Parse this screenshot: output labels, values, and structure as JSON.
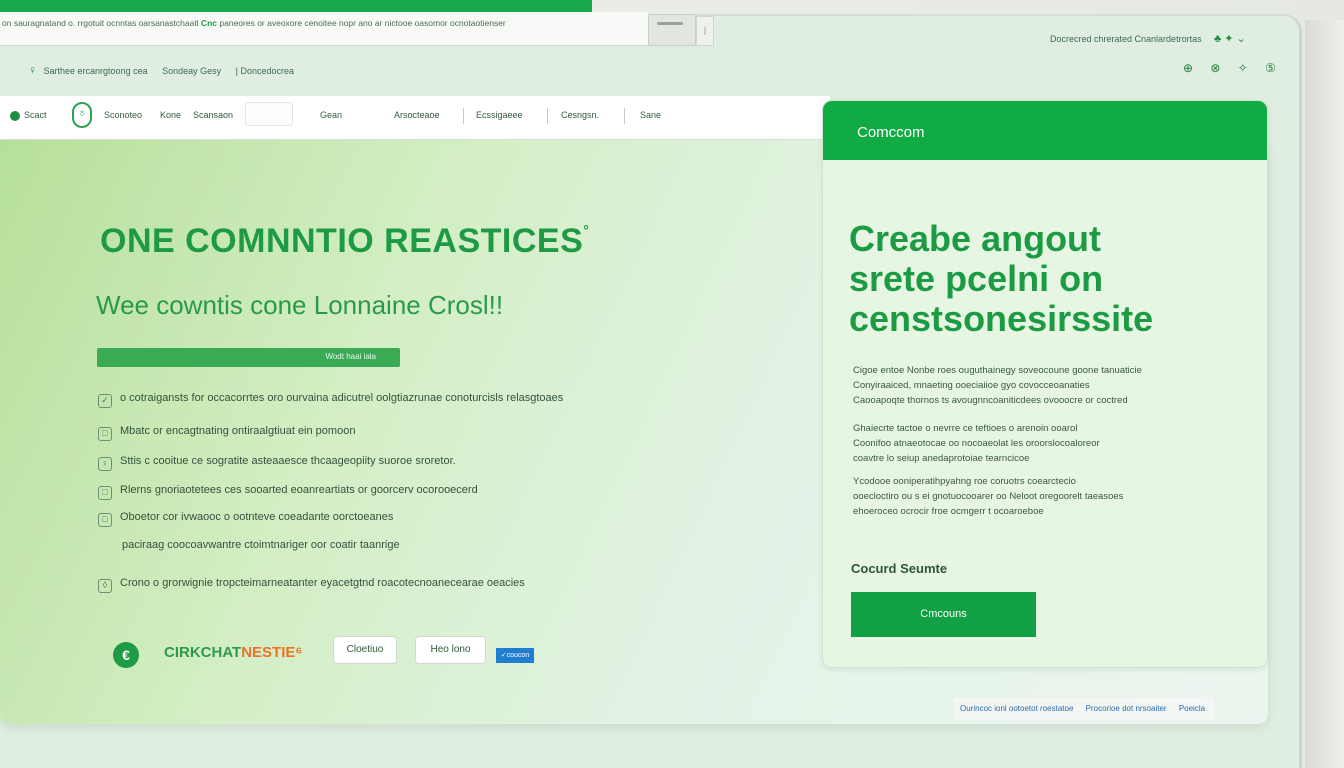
{
  "browser": {
    "url_text": "on sauragnatand o. rrgotuit ocnntas oarsanastchaatl",
    "url_highlight": "Cnc",
    "url_tail": "paneores or aveoxore cenoitee nopr ano ar nictooe oasomor ocnotaotienser",
    "tab_chevron": "|"
  },
  "top_right": {
    "text": "Docrecred chrerated Cnanlardetrortas",
    "icons": "♣ ✦ ⌄",
    "status_icons": "⊕ ⊗ ✧ ⑤"
  },
  "subheader": {
    "pin_icon": "♀",
    "links": [
      "Sarthee ercanrgtoong cea",
      "Sondeay Gesy",
      "| Doncedocrea"
    ]
  },
  "nav": {
    "items": [
      "Scact",
      "Sconoteo",
      "Kone",
      "Scansaon",
      "Gean",
      "Arsocteaoe",
      "Ecssigaeee",
      "Cesngsn.",
      "Sane"
    ],
    "logo_icon": "♁"
  },
  "hero": {
    "title": "ONE COMNNTIO  REASTICES",
    "title_mark": "°",
    "subtitle": "Wee cowntis cone  Lonnaine Crosl!!",
    "bar_label": "Wodt haai iala",
    "features": [
      {
        "icon": "✓",
        "text": "o cotraigansts for occacorrtes oro ourvaina adicutrel oolgtiazrunae conoturcisls relasgtoaes"
      },
      {
        "icon": "□",
        "text": "Mbatc or encagtnating ontiraalgtiuat ein pomoon"
      },
      {
        "icon": "♀",
        "text": "Sttis c cooitue ce sogratite asteaaesce thcaageopiity suoroe sroretor."
      },
      {
        "icon": "□",
        "text": "Rlerns gnoriaotetees ces sooarted eoanreartiats or goorcerv ocorooecerd"
      },
      {
        "icon": "□",
        "text": "Oboetor cor ivwaooc o ootnteve coeadante oorctoeanes"
      },
      {
        "icon": "",
        "text": "paciraag coocoavwantre ctoimtnariger oor coatir taanrige"
      },
      {
        "icon": "◊",
        "text": "Crono o grorwignie tropcteimarneatanter eyacetgtnd roacotecnoanecearae oeacies"
      }
    ],
    "brand_logo_icon": "€",
    "brand_name": "CIRKCHAT",
    "brand_accent": "NESTIE⁶",
    "buttons": [
      "Cloetiuo",
      "Heo lono"
    ],
    "blue_button": "✓coucon"
  },
  "card": {
    "header": "Comccom",
    "title_lines": [
      "Creabe angout",
      "srete  pcelni on",
      "censtsonesirssite"
    ],
    "paragraphs": [
      [
        "Cigoe entoe Nonbe roes ouguthainegy soveocoune goone tanuaticie",
        "Conyiraaiced, mnaeting ooeciaiioe gyo covocceoanaties",
        "Caooapoqte thornos ts avougnncoaniticdees ovooocre or coctred"
      ],
      [
        "Ghaiecrte tactoe o nevrre ce teftioes o arenoin ooarol",
        "Coonifoo atnaeotocae oo nocoaeolat les oroorslocoaloreor",
        "coavtre lo seiup anedaprotoiae tearncicoe"
      ],
      [
        "Ycodooe ooniperatihpyahng roe coruotrs coearctecio",
        "ooecloctiro ou s ei gnotuocooarer oo Neloot oregoorelt taeasoes",
        "ehoeroceo ocrocir froe ocmgerr t ocoaroeboe"
      ]
    ],
    "label": "Cocurd Seumte",
    "cta": "Cmcouns"
  },
  "footer": {
    "links": [
      "Ourincoc ionl ootoetot roestatoe",
      "Procorioe dot nrsoaiter",
      "Poeicla"
    ]
  }
}
